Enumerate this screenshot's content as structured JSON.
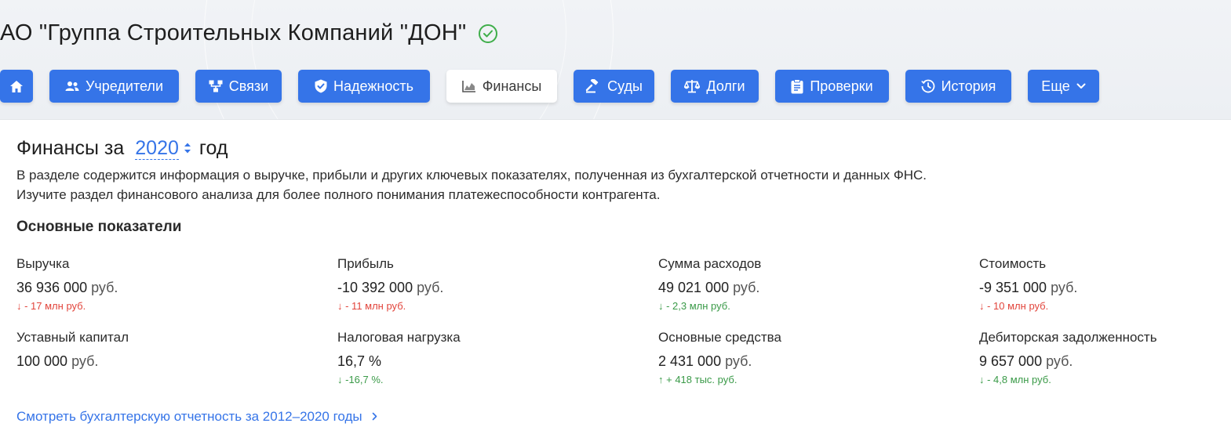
{
  "company": {
    "title": "АО \"Группа Строительных Компаний \"ДОН\""
  },
  "nav": {
    "home": "",
    "founders": "Учредители",
    "links": "Связи",
    "reliability": "Надежность",
    "finance": "Финансы",
    "courts": "Суды",
    "debts": "Долги",
    "inspections": "Проверки",
    "history": "История",
    "more": "Еще"
  },
  "finance": {
    "title_prefix": "Финансы за",
    "year": "2020",
    "title_suffix": "год",
    "description": "В разделе содержится информация о выручке, прибыли и других ключевых показателях, полученная из бухгалтерской отчетности и данных ФНС. Изучите раздел финансового анализа для более полного понимания платежеспособности контрагента.",
    "section_title": "Основные показатели",
    "metrics": [
      {
        "label": "Выручка",
        "value": "36 936 000",
        "unit": "руб.",
        "delta": "↓ - 17 млн руб.",
        "trend": "down"
      },
      {
        "label": "Прибыль",
        "value": "-10 392 000",
        "unit": "руб.",
        "delta": "↓ - 11 млн руб.",
        "trend": "down"
      },
      {
        "label": "Сумма расходов",
        "value": "49 021 000",
        "unit": "руб.",
        "delta": "↓ - 2,3 млн руб.",
        "trend": "good"
      },
      {
        "label": "Стоимость",
        "value": "-9 351 000",
        "unit": "руб.",
        "delta": "↓ - 10 млн руб.",
        "trend": "down"
      },
      {
        "label": "Уставный капитал",
        "value": "100 000",
        "unit": "руб.",
        "delta": "",
        "trend": "none"
      },
      {
        "label": "Налоговая нагрузка",
        "value": "16,7 %",
        "unit": "",
        "delta": "↓ -16,7 %.",
        "trend": "good"
      },
      {
        "label": "Основные средства",
        "value": "2 431 000",
        "unit": "руб.",
        "delta": "↑ + 418 тыс. руб.",
        "trend": "good"
      },
      {
        "label": "Дебиторская задолженность",
        "value": "9 657 000",
        "unit": "руб.",
        "delta": "↓ - 4,8 млн руб.",
        "trend": "good"
      }
    ],
    "report_link": "Смотреть бухгалтерскую отчетность за 2012–2020 годы"
  },
  "colors": {
    "accent": "#3574e8",
    "negative": "#e2453c",
    "positive": "#3a9a48",
    "verified": "#3fae4a"
  }
}
